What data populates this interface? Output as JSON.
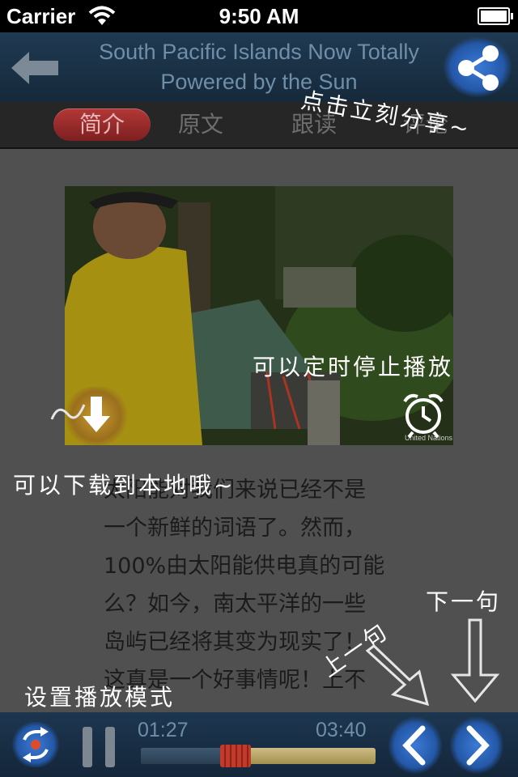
{
  "status_bar": {
    "carrier": "Carrier",
    "time": "9:50 AM"
  },
  "nav": {
    "title": "South Pacific Islands Now Totally Powered by the Sun",
    "back_icon": "back-arrow-icon",
    "share_icon": "share-icon"
  },
  "tabs": [
    {
      "label": "简介",
      "active": true
    },
    {
      "label": "原文",
      "active": false
    },
    {
      "label": "跟读",
      "active": false
    },
    {
      "label": "评论",
      "active": false
    }
  ],
  "video": {
    "watermark": "United Nations"
  },
  "article": {
    "lines": [
      "太阳能对我们来说已经不是",
      "一个新鲜的词语了。然而，",
      "100%由太阳能供电真的可能",
      "么？如今，南太平洋的一些",
      "岛屿已经将其变为现实了！",
      "这真是一个好事情呢！上不"
    ]
  },
  "tutorial_hints": {
    "share": "点击立刻分享~",
    "timer": "可以定时停止播放",
    "download": "可以下载到本地哦~",
    "next": "下一句",
    "prev": "上一句",
    "mode": "设置播放模式"
  },
  "player": {
    "current_time": "01:27",
    "total_time": "03:40",
    "progress": 0.403,
    "state": "playing"
  }
}
